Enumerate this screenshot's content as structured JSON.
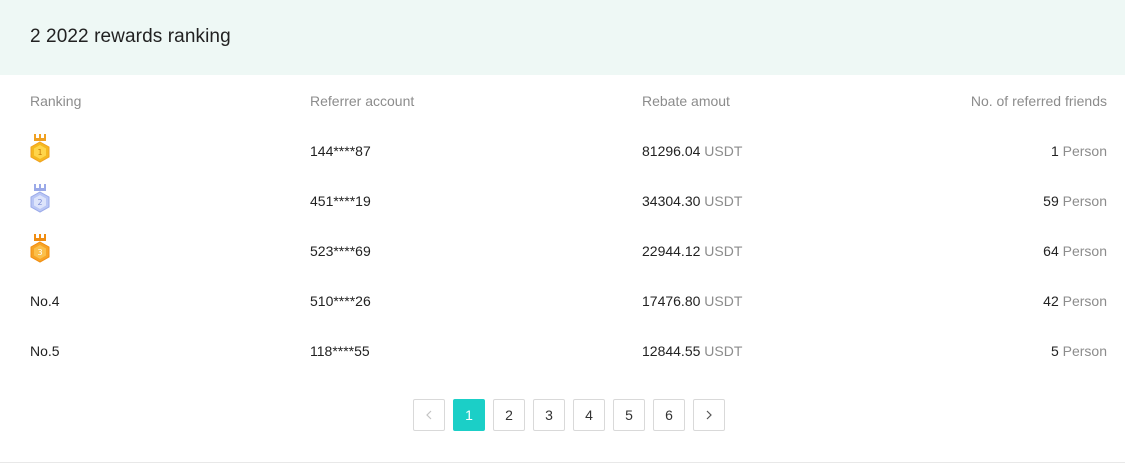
{
  "header": {
    "title": "2 2022 rewards ranking"
  },
  "table": {
    "columns": {
      "ranking": "Ranking",
      "account": "Referrer account",
      "rebate": "Rebate amout",
      "friends": "No. of referred friends"
    },
    "rows": [
      {
        "rank": "1",
        "medal": "gold",
        "account": "144****87",
        "rebate": "81296.04",
        "rebate_unit": "USDT",
        "friends": "1",
        "friends_unit": "Person"
      },
      {
        "rank": "2",
        "medal": "silver",
        "account": "451****19",
        "rebate": "34304.30",
        "rebate_unit": "USDT",
        "friends": "59",
        "friends_unit": "Person"
      },
      {
        "rank": "3",
        "medal": "bronze",
        "account": "523****69",
        "rebate": "22944.12",
        "rebate_unit": "USDT",
        "friends": "64",
        "friends_unit": "Person"
      },
      {
        "rank": "No.4",
        "account": "510****26",
        "rebate": "17476.80",
        "rebate_unit": "USDT",
        "friends": "42",
        "friends_unit": "Person"
      },
      {
        "rank": "No.5",
        "account": "118****55",
        "rebate": "12844.55",
        "rebate_unit": "USDT",
        "friends": "5",
        "friends_unit": "Person"
      }
    ]
  },
  "pagination": {
    "pages": [
      "1",
      "2",
      "3",
      "4",
      "5",
      "6"
    ],
    "current": "1",
    "prev_icon": "chevron-left-icon",
    "next_icon": "chevron-right-icon"
  },
  "colors": {
    "header_bg": "#eef8f5",
    "accent": "#1bcfc7",
    "muted_text": "#8c8c8c",
    "gold": "#f5b81f",
    "silver": "#a9b8f0",
    "bronze": "#f7a325"
  }
}
